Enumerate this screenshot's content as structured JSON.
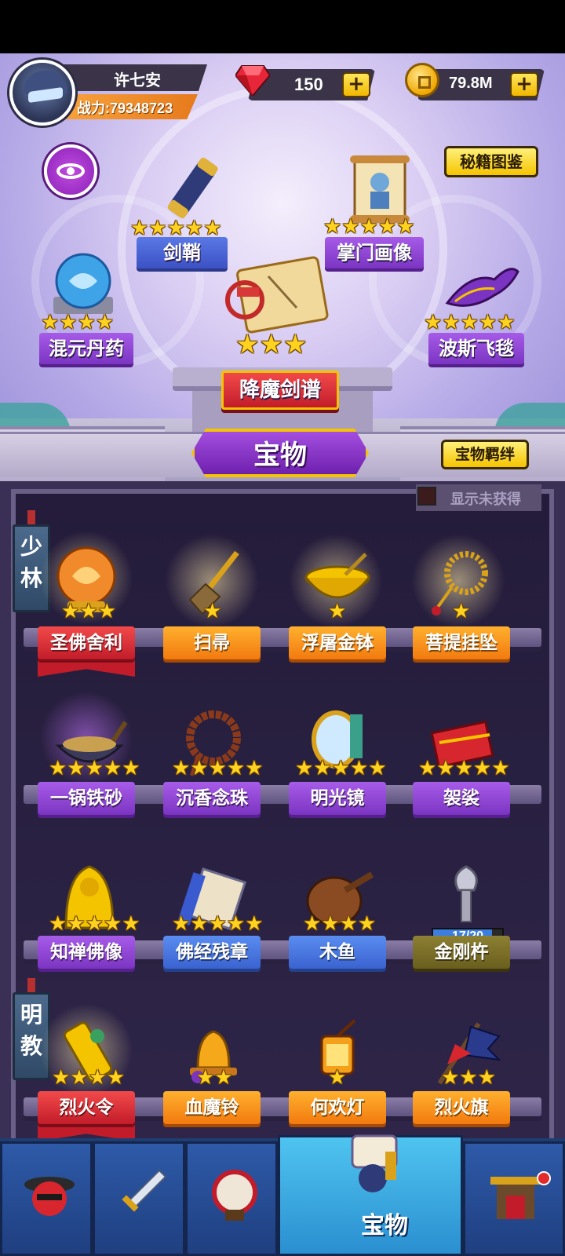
{
  "header": {
    "player_name": "许七安",
    "power_text": "战力:79348723",
    "gems": "150",
    "gold": "79.8M",
    "plus": "+"
  },
  "buttons": {
    "secret_guide": "秘籍图鉴",
    "treasure_bond": "宝物羁绊",
    "show_unobtained": "显示未获得"
  },
  "showcase": {
    "tab_title": "宝物",
    "items": [
      {
        "name": "剑鞘",
        "stars": "★★★★★"
      },
      {
        "name": "掌门画像",
        "stars": "★★★★★"
      },
      {
        "name": "混元丹药",
        "stars": "★★★★"
      },
      {
        "name": "降魔剑谱",
        "stars": "★★★"
      },
      {
        "name": "波斯飞毯",
        "stars": "★★★★★"
      }
    ]
  },
  "sections": [
    {
      "name": "少林"
    },
    {
      "name": "明教"
    }
  ],
  "items": [
    {
      "name": "圣佛舍利",
      "stars": "★★★"
    },
    {
      "name": "扫帚",
      "stars": "★"
    },
    {
      "name": "浮屠金钵",
      "stars": "★"
    },
    {
      "name": "菩提挂坠",
      "stars": "★"
    },
    {
      "name": "一锅铁砂",
      "stars": "★★★★★"
    },
    {
      "name": "沉香念珠",
      "stars": "★★★★★"
    },
    {
      "name": "明光镜",
      "stars": "★★★★★"
    },
    {
      "name": "袈裟",
      "stars": "★★★★★"
    },
    {
      "name": "知禅佛像",
      "stars": "★★★★★"
    },
    {
      "name": "佛经残章",
      "stars": "★★★★★"
    },
    {
      "name": "木鱼",
      "stars": "★★★★"
    },
    {
      "name": "金刚杵",
      "progress": "17/20",
      "progress_value": 0.85
    },
    {
      "name": "烈火令",
      "stars": "★★★★"
    },
    {
      "name": "血魔铃",
      "stars": "★★"
    },
    {
      "name": "何欢灯",
      "stars": "★"
    },
    {
      "name": "烈火旗",
      "stars": "★★★"
    }
  ],
  "nav": {
    "active_label": "宝物"
  },
  "colors": {
    "accent_yellow": "#f5c400",
    "purple": "#7b34c2",
    "orange": "#f27a0f",
    "blue_nav": "#1f3f80"
  }
}
